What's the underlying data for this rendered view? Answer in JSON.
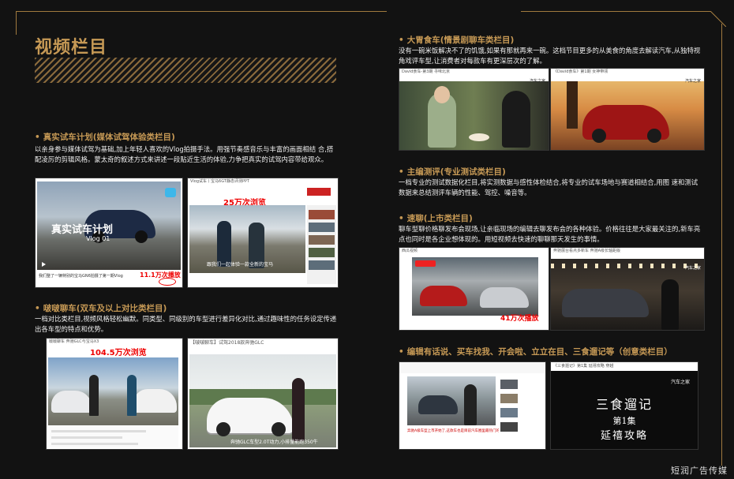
{
  "page": {
    "title": "视频栏目",
    "watermark": "短润广告传媒"
  },
  "colors": {
    "accent": "#c69955",
    "background": "#121212",
    "text": "#f0f0f0",
    "highlight": "#e00000"
  },
  "sections": {
    "s1": {
      "heading": "真实试车计划(媒体试驾体验类栏目)",
      "body": "以亲身参与媒体试驾为基础,加上年轻人喜欢的Vlog拍摄手法。用强节奏感音乐与丰富的画面相结 合,搭配凌厉的剪辑风格。蒙太奇的叙述方式来讲述一段贴近生活的体验,力争把真实的试驾内容带给观众。",
      "shot1_overlay": "真实试车计划",
      "shot1_sub": "Vlog 01",
      "shot1_caption": "我们整了一辆特别的宝马GN6拍摄了第一期Vlog",
      "shot1_views": "11.1万次播放",
      "shot2_bar": "Vlog试车丨宝马6GT静态评测PPT",
      "shot2_views": "25万次浏览",
      "shot2_caption": "跟我们一起体验一款全新的宝马",
      "shot2_tag": "汽车之家"
    },
    "s2": {
      "heading": "啵啵聊车(双车及以上对比类栏目)",
      "body": "一档对比类栏目,视频风格轻松幽默。同类型、同级别的车型进行差异化对比,通过趣味性的任务设定传递出各车型的特点和优势。",
      "shot1_bar": "啵啵聊车 奔驰GLC与宝马X3",
      "shot1_views": "104.5万次浏览",
      "shot2_bar": "【啵啵聊车】试驾2018款奔驰GLC",
      "shot2_caption": "奔驰GLC车型2.0T动力,小排量能跑350牛"
    },
    "s3": {
      "heading": "大胃食车(情景剧聊车类栏目)",
      "body": "没有一碗米饭解决不了的饥饿,如果有那就再来一碗。这档节目更多的从美食的角度去解读汽车,从独特视角戏评车型,让消费者对每款车有更深层次的了解。",
      "shot1_bar": "David食车-第3期 寻味北京",
      "shot1_tag": "汽车之家",
      "shot2_bar": "《David食车》第1期 女神带领",
      "shot2_tag": "汽车之家"
    },
    "s4": {
      "heading": "主编测评(专业测试类栏目)",
      "body": "一档专业的测试数据化栏目,将实测数据与感性体检结合,将专业的试车场地与赛道相结合,用图 速和测试数据来总结测评车辆的性能、驾控、噪音等。"
    },
    "s5": {
      "heading": "速聊(上市类栏目)",
      "body": "聊车型聊价格聊发布会现场,让亲临现场的编辑去聊发布会的各种体验。价格往往是大家最关注的,新车亮点也同时是各企业想体现的。用短视频去快速的聊聊那天发生的事情。",
      "shot1_bar": "西瓜视频",
      "shot1_views": "41万次播放",
      "shot2_bar": "奔驰展台看点多新车 奔驰A级长轴距版",
      "shot2_tag": "汽车之家"
    },
    "s6": {
      "heading": "编辑有话说、买车找我、开会啦、立立在目、三食遛记等（创意类栏目）",
      "shot1_caption": "奔驰A级车型上市开始了,这款车也是目前汽车圈里最热门的",
      "shot2_bar": "《三食遛记》第1集 延禧攻略 穿越",
      "shot2_title": "三食遛记",
      "shot2_ep": "第1集",
      "shot2_name": "延禧攻略",
      "shot2_tag": "汽车之家"
    }
  }
}
